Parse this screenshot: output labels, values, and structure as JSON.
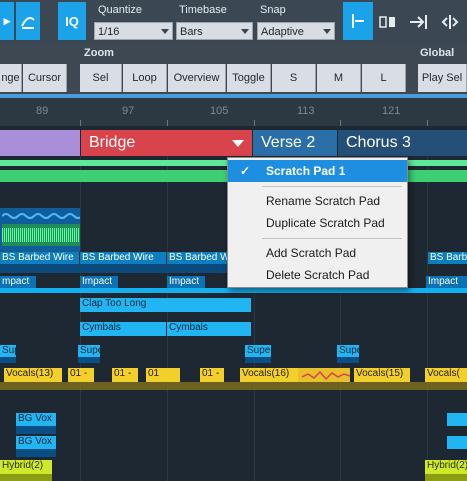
{
  "toolbar": {
    "iq_label": "IQ",
    "quantize": {
      "label": "Quantize",
      "value": "1/16"
    },
    "timebase": {
      "label": "Timebase",
      "value": "Bars"
    },
    "snap": {
      "label": "Snap",
      "value": "Adaptive"
    }
  },
  "zoom_row": {
    "zoom_title": "Zoom",
    "global_title": "Global",
    "buttons": [
      "nge",
      "Cursor",
      "Sel",
      "Loop",
      "Overview",
      "Toggle",
      "S",
      "M",
      "L",
      "Play Sel"
    ]
  },
  "ruler": {
    "marks": [
      "89",
      "97",
      "105",
      "113",
      "121"
    ]
  },
  "sections": [
    {
      "label": "",
      "color": "#a98fd8"
    },
    {
      "label": "Bridge",
      "color": "#d9434b"
    },
    {
      "label": "Verse 2",
      "color": "#2a6fa8"
    },
    {
      "label": "Chorus 3",
      "color": "#244f77"
    }
  ],
  "clips": {
    "bs_barbed_wire": "BS Barbed Wire",
    "impact": "Impact",
    "impact_short": "mpact",
    "clap_too_long": "Clap Too Long",
    "cymbals": "Cymbals",
    "supe": "Supe",
    "sup": "Sup",
    "vocals13": "Vocals(13)",
    "vocals16": "Vocals(16)",
    "vocals15": "Vocals(15)",
    "vocals_trunc": "Vocals(",
    "v01": "01 -",
    "v01b": "01 -",
    "v01c": "01",
    "v01d": "01 -",
    "bg_vox": "BG Vox",
    "hybrid2": "Hybrid(2)"
  },
  "context_menu": {
    "items": [
      {
        "label": "Scratch Pad 1",
        "checked": true
      },
      {
        "label": "Rename Scratch Pad"
      },
      {
        "label": "Duplicate Scratch Pad"
      },
      {
        "label": "Add Scratch Pad"
      },
      {
        "label": "Delete Scratch Pad"
      }
    ],
    "check_glyph": "✓"
  },
  "colors": {
    "accent_blue": "#1aa3e8",
    "menu_highlight": "#1e8fe0",
    "bridge_red": "#d9434b"
  }
}
